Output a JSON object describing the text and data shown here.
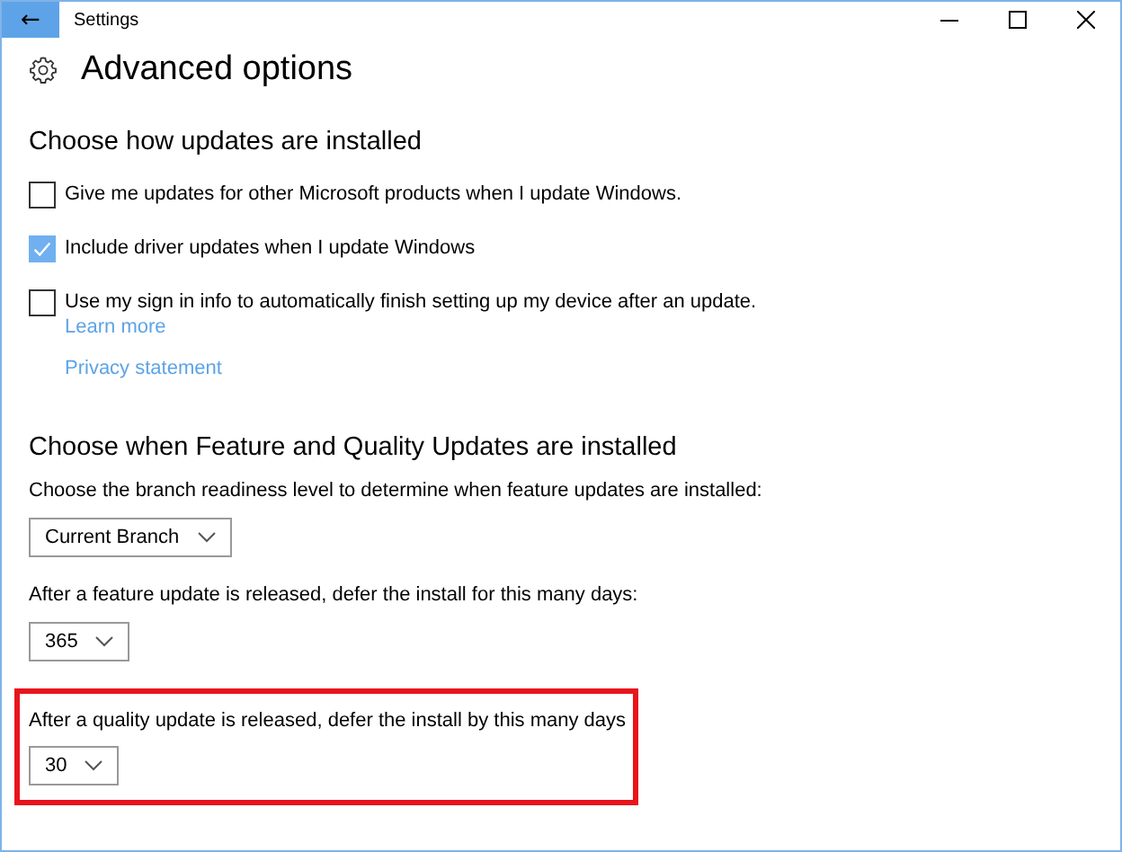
{
  "window": {
    "title": "Settings",
    "back_symbol": "←"
  },
  "page_title": "Advanced options",
  "sections": [
    {
      "heading": "Choose how updates are installed",
      "items": [
        {
          "kind": "checkbox",
          "label": "Give me updates for other Microsoft products when I update Windows.",
          "checked": false
        },
        {
          "kind": "checkbox",
          "label": "Include driver updates when I update Windows",
          "checked": true
        },
        {
          "kind": "checkbox",
          "label": "Use my sign in info to automatically finish setting up my device after an update.",
          "checked": false,
          "links": [
            "Learn more",
            "Privacy statement"
          ]
        }
      ]
    },
    {
      "heading": "Choose when Feature and Quality Updates are installed",
      "items": [
        {
          "kind": "dropdown",
          "label": "Choose the branch readiness level to determine when feature updates are installed:",
          "value": "Current Branch",
          "highlighted": false
        },
        {
          "kind": "dropdown",
          "label": "After a feature update is released, defer the install for this many days:",
          "value": "365",
          "highlighted": false
        },
        {
          "kind": "dropdown",
          "label": "After a quality update is released, defer the install by this many days",
          "value": "30",
          "highlighted": true
        }
      ]
    }
  ]
}
